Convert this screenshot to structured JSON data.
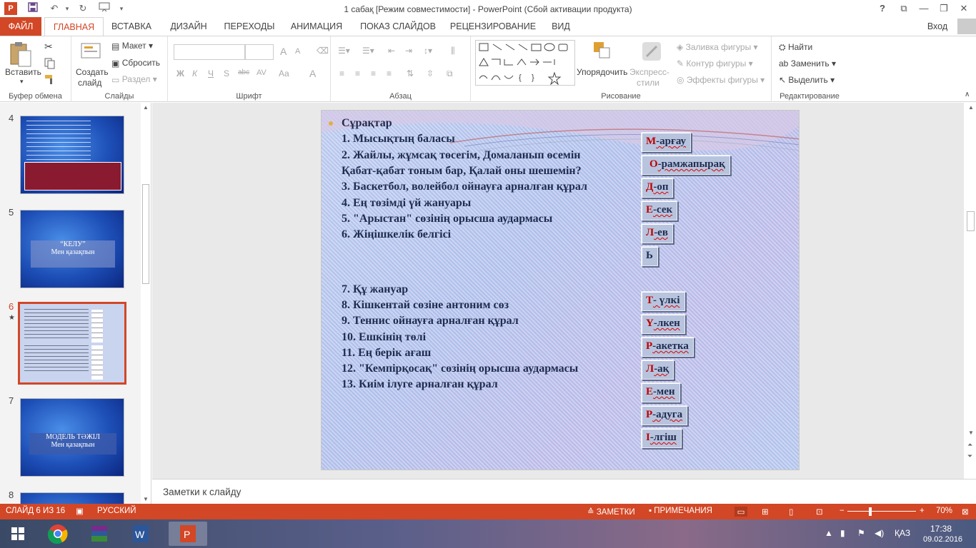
{
  "window": {
    "title": "1 сабақ [Режим совместимости] - PowerPoint (Сбой активации продукта)",
    "help": "?",
    "signin": "Вход"
  },
  "tabs": [
    "ФАЙЛ",
    "ГЛАВНАЯ",
    "ВСТАВКА",
    "ДИЗАЙН",
    "ПЕРЕХОДЫ",
    "АНИМАЦИЯ",
    "ПОКАЗ СЛАЙДОВ",
    "РЕЦЕНЗИРОВАНИЕ",
    "ВИД"
  ],
  "ribbon": {
    "clipboard": {
      "label": "Буфер обмена",
      "paste": "Вставить"
    },
    "slides": {
      "label": "Слайды",
      "create": "Создать",
      "create2": "слайд",
      "layout": "Макет",
      "reset": "Сбросить",
      "section": "Раздел"
    },
    "font": {
      "label": "Шрифт",
      "bold": "Ж",
      "italic": "К",
      "underline": "Ч",
      "strike": "S",
      "abc": "abc",
      "spacing": "AV",
      "case": "Aa",
      "color": "A",
      "grow": "A",
      "shrink": "A"
    },
    "paragraph": {
      "label": "Абзац"
    },
    "drawing": {
      "label": "Рисование",
      "arrange": "Упорядочить",
      "styles": "Экспресс-",
      "styles2": "стили",
      "fill": "Заливка фигуры",
      "outline": "Контур фигуры",
      "effects": "Эффекты фигуры"
    },
    "editing": {
      "label": "Редактирование",
      "find": "Найти",
      "replace": "Заменить",
      "select": "Выделить"
    }
  },
  "thumbnails": [
    {
      "num": "4",
      "caption": ""
    },
    {
      "num": "5",
      "caption1": "“КЕЛУ”",
      "caption2": "Мен қазақпын"
    },
    {
      "num": "6",
      "caption": ""
    },
    {
      "num": "7",
      "caption1": "МОДЕЛЬ ТӘЖІЛ",
      "caption2": "Мен қазақпын"
    },
    {
      "num": "8",
      "caption": ""
    }
  ],
  "slide": {
    "heading": "Сұрақтар",
    "questions": [
      "1. Мысықтың баласы",
      "2. Жайлы, жұмсақ төсегім, Домаланып өсемін",
      "Қабат-қабат тоным бар, Қалай оны шешемін?",
      "3. Баскетбол, волейбол ойнауға арналған құрал",
      "4. Ең төзімді үй жануары",
      "5. \"Арыстан\" сөзінің орысша аудармасы",
      "6. Жіңішкелік белгісі",
      "7. Құ жануар",
      "8. Кішкентай сөзіне антоним сөз",
      "9. Теннис ойнауға арналған құрал",
      "10. Ешкінің төлі",
      "11. Ең берік ағаш",
      "12. \"Кемпірқосақ\" сөзінің орысша аудармасы",
      "13. Киім ілуге арналған құрал"
    ],
    "answers": [
      {
        "first": "М",
        "rest": "-арғау"
      },
      {
        "first": "О",
        "rest": "-рамжапырақ"
      },
      {
        "first": "Д",
        "rest": "-оп"
      },
      {
        "first": "Е",
        "rest": "-сек"
      },
      {
        "first": "Л",
        "rest": "-ев"
      },
      {
        "first": "Ь",
        "rest": ""
      },
      {
        "first": "Т",
        "rest": "- үлкі"
      },
      {
        "first": "Ү",
        "rest": "-лкен"
      },
      {
        "first": "Р",
        "rest": "-акетка"
      },
      {
        "first": "Л",
        "rest": "-ақ"
      },
      {
        "first": "Е",
        "rest": "-мен"
      },
      {
        "first": "Р",
        "rest": "-адуга"
      },
      {
        "first": "І",
        "rest": "-лгіш"
      }
    ]
  },
  "notes": {
    "placeholder": "Заметки к слайду"
  },
  "status": {
    "slide": "СЛАЙД 6 ИЗ 16",
    "lang": "РУССКИЙ",
    "notes": "ЗАМЕТКИ",
    "comments": "ПРИМЕЧАНИЯ",
    "zoom": "70%"
  },
  "taskbar": {
    "lang": "ҚАЗ",
    "time": "17:38",
    "date": "09.02.2016"
  },
  "colors": {
    "accent": "#d24726",
    "answer_first": "#c00000",
    "question_text": "#1f2c4f"
  }
}
